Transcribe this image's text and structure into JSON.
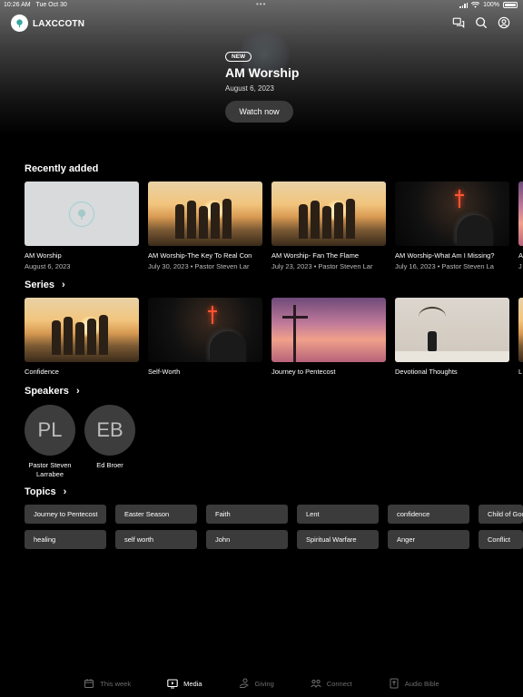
{
  "status": {
    "time": "10:26 AM",
    "date": "Tue Oct 30",
    "battery": "100%"
  },
  "app": {
    "brand": "LAXCCOTN"
  },
  "icons": {
    "chat": "chat-icon",
    "search": "search-icon",
    "account": "account-icon"
  },
  "hero": {
    "badge": "NEW",
    "title": "AM Worship",
    "date": "August 6, 2023",
    "button": "Watch now"
  },
  "recent": {
    "title": "Recently added",
    "items": [
      {
        "title": "AM Worship",
        "sub": "August 6, 2023"
      },
      {
        "title": "AM Worship-The Key To Real Con",
        "sub": "July 30, 2023 • Pastor Steven Lar"
      },
      {
        "title": "AM Worship- Fan The Flame",
        "sub": "July 23, 2023 • Pastor Steven Lar"
      },
      {
        "title": "AM Worship-What Am I Missing?",
        "sub": "July 16, 2023 • Pastor Steven La"
      },
      {
        "title": "A",
        "sub": "J"
      }
    ]
  },
  "series": {
    "title": "Series",
    "items": [
      {
        "title": "Confidence"
      },
      {
        "title": "Self-Worth"
      },
      {
        "title": "Journey to Pentecost"
      },
      {
        "title": "Devotional Thoughts"
      },
      {
        "title": "L"
      }
    ]
  },
  "speakers": {
    "title": "Speakers",
    "items": [
      {
        "initials": "PL",
        "name": "Pastor Steven Larrabee"
      },
      {
        "initials": "EB",
        "name": "Ed Broer"
      }
    ]
  },
  "topics": {
    "title": "Topics",
    "row1": [
      "Journey to Pentecost",
      "Easter Season",
      "Faith",
      "Lent",
      "confidence",
      "Child of God"
    ],
    "row2": [
      "healing",
      "self worth",
      "John",
      "Spiritual Warfare",
      "Anger",
      "Conflict"
    ]
  },
  "tabs": [
    {
      "label": "This week",
      "icon": "calendar-icon",
      "active": false
    },
    {
      "label": "Media",
      "icon": "tv-icon",
      "active": true
    },
    {
      "label": "Giving",
      "icon": "giving-icon",
      "active": false
    },
    {
      "label": "Connect",
      "icon": "people-icon",
      "active": false
    },
    {
      "label": "Audio Bible",
      "icon": "bible-icon",
      "active": false
    }
  ]
}
